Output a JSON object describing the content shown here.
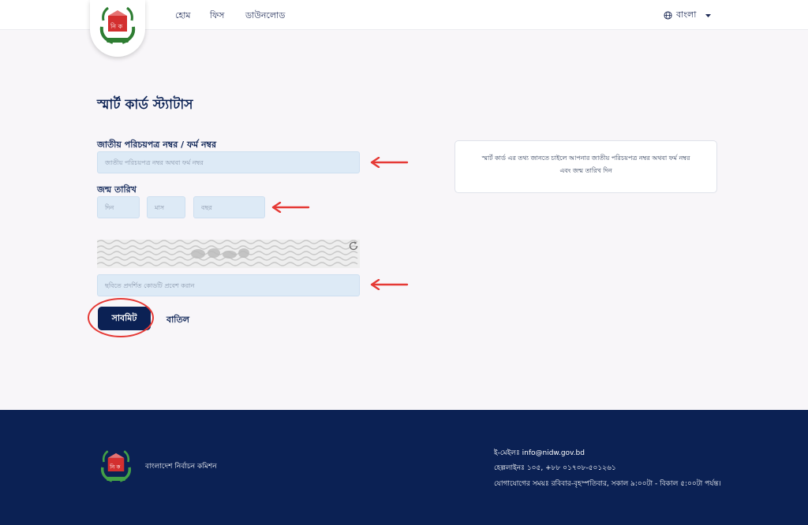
{
  "header": {
    "nav": [
      "হোম",
      "ফিস",
      "ডাউনলোড"
    ],
    "language": "বাংলা"
  },
  "form": {
    "title": "স্মার্ট কার্ড স্ট্যাটাস",
    "nid_label": "জাতীয় পরিচয়পত্র নম্বর / ফর্ম নম্বর",
    "nid_placeholder": "জাতীয় পরিচয়পত্র নম্বর অথবা ফর্ম নম্বর",
    "dob_label": "জন্ম তারিখ",
    "day_placeholder": "দিন",
    "month_placeholder": "মাস",
    "year_placeholder": "বছর",
    "captcha_placeholder": "ছবিতে প্রদর্শিত কোডটি প্রবেশ করান",
    "submit_label": "সাবমিট",
    "cancel_label": "বাতিল"
  },
  "info": {
    "text": "স্মার্ট কার্ড এর তথ্য জানতে চাইলে আপনার জাতীয় পরিচয়পত্র নম্বর অথবা ফর্ম নম্বর এবং জন্ম তারিখ দিন"
  },
  "footer": {
    "org_name": "বাংলাদেশ নির্বাচন কমিশন",
    "email": "ই-মেইলঃ info@nidw.gov.bd",
    "helpline": "হেল্পলাইনঃ ১০৫, +৮৮ ০১৭০৮-৫০১২৬১",
    "hours": "যোগাযোগের সময়ঃ রবিবার-বৃহস্পতিবার, সকাল ৯:০০টা - বিকাল ৫:০০টা পর্যন্ত।"
  },
  "colors": {
    "navy": "#0b2154",
    "input_bg": "#ddeaf6",
    "annotation_red": "#e53935"
  }
}
